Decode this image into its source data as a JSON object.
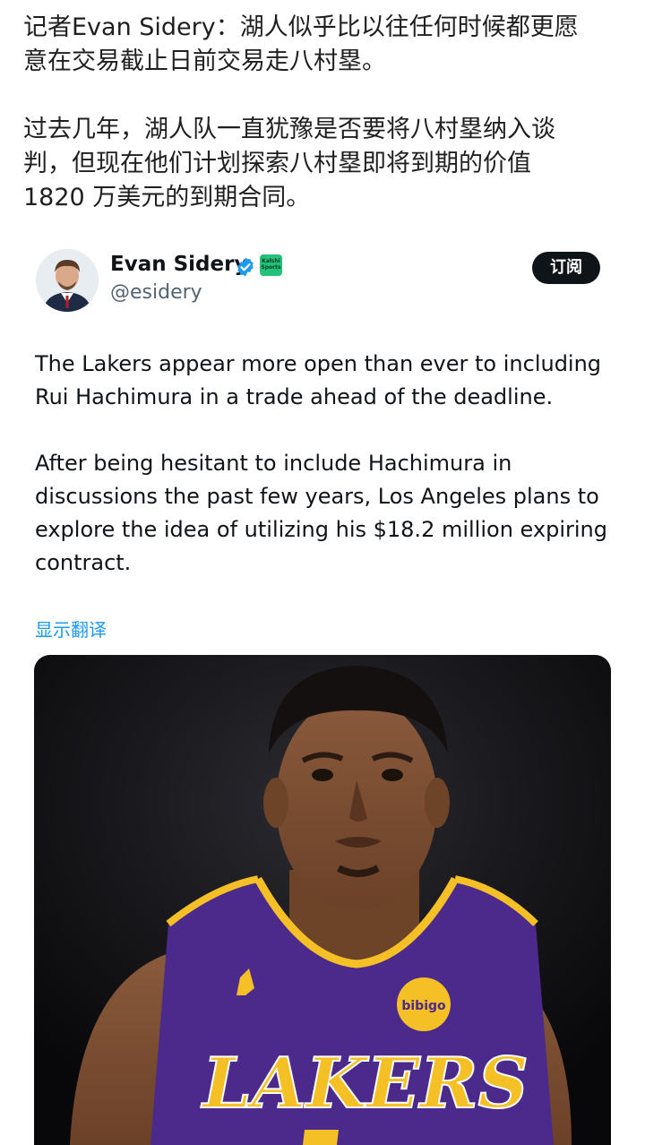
{
  "post": {
    "line1": "记者Evan Sidery：湖人似乎比以往任何时候都更愿",
    "line2": "意在交易截止日前交易走八村塁。",
    "line3": "过去几年，湖人队一直犹豫是否要将八村塁纳入谈",
    "line4": "判，但现在他们计划探索八村塁即将到期的价值",
    "line5": "1820 万美元的到期合同。"
  },
  "tweet": {
    "author_name": "Evan Sidery",
    "handle": "@esidery",
    "affiliation_badge": "Kalshi Sports",
    "subscribe_label": "订阅",
    "paragraph1": "The Lakers appear more open than ever to including Rui Hachimura in a trade ahead of the deadline.",
    "paragraph2": "After being hesitant to include Hachimura in discussions the past few years, Los Angeles plans to explore the idea of utilizing his $18.2 million expiring contract.",
    "translate_label": "显示翻译",
    "jersey_text": "LAKERS",
    "patch_text": "bibigo",
    "colors": {
      "verified": "#1d9bf0",
      "translate": "#1d9bf0",
      "lakers_purple": "#4b2a8c",
      "lakers_gold": "#f5c026"
    }
  }
}
